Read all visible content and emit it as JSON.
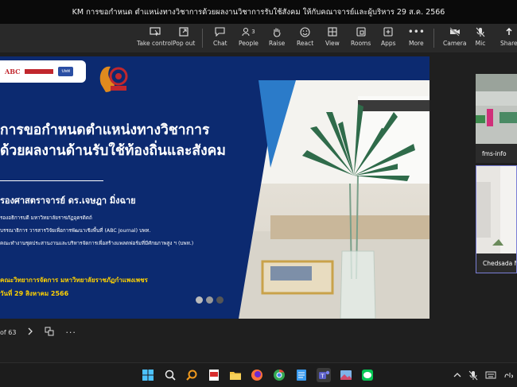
{
  "window": {
    "title": "KM การขอกำหนด ตำแหน่งทางวิชาการด้วยผลงานวิชาการรับใช้สังคม ให้กับคณาจารย์และผู้บริหาร 29 ส.ค. 2566"
  },
  "toolbar": {
    "take_control": "Take control",
    "pop_out": "Pop out",
    "chat": "Chat",
    "people": "People",
    "people_count": "3",
    "raise": "Raise",
    "react": "React",
    "view": "View",
    "rooms": "Rooms",
    "apps": "Apps",
    "more": "More",
    "camera": "Camera",
    "mic": "Mic",
    "share": "Share"
  },
  "slide": {
    "logo_abc": "ABC",
    "logo_bpt": "บพท",
    "title_line1": "การขอกำหนดตำแหน่งทางวิชาการ",
    "title_line2": "ด้วยผลงานด้านรับใช้ท้องถิ่นและสังคม",
    "presenter": "รองศาสตราจารย์ ดร.เจษฎา มิ่งฉาย",
    "info": [
      "รองอธิการบดี มหาวิทยาลัยราชภัฏอุตรดิตถ์",
      "บรรณาธิการ วารสารวิจัยเพื่อการพัฒนาเชิงพื้นที่ (ABC Journal) บพท.",
      "คณะทำงานชุดประสานงานและบริหารจัดการเพื่อสร้างแพลตฟอร์มที่มีศักยภาพสูง ฯ (บพท.)"
    ],
    "org": "คณะวิทยาการจัดการ มหาวิทยาลัยราชภัฏกำแพงเพชร",
    "date": "วันที่ 29 สิงหาคม 2566"
  },
  "slide_controls": {
    "counter": "of 63"
  },
  "participants": [
    {
      "name": "fms-info"
    },
    {
      "name": "Chedsada Mi"
    }
  ],
  "colors": {
    "slide_bg": "#0c2a70",
    "accent_yellow": "#ffd200",
    "titlebar": "#0a0a0a"
  }
}
